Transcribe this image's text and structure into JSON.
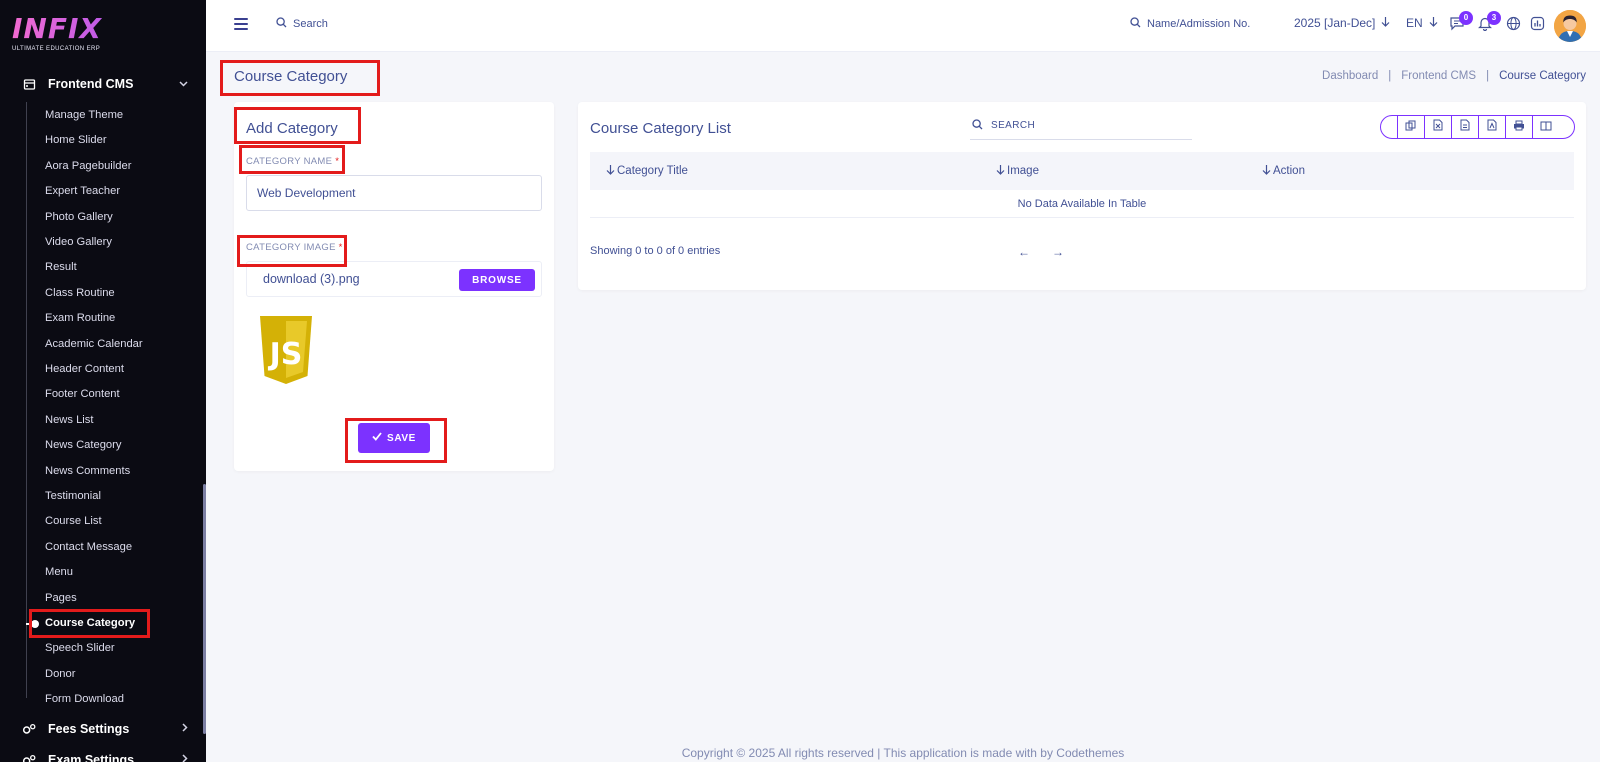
{
  "brand": {
    "logo_text": "INFIX",
    "tagline": "ULTIMATE EDUCATION ERP"
  },
  "sidebar": {
    "section_open": "Frontend CMS",
    "items": [
      "Manage Theme",
      "Home Slider",
      "Aora Pagebuilder",
      "Expert Teacher",
      "Photo Gallery",
      "Video Gallery",
      "Result",
      "Class Routine",
      "Exam Routine",
      "Academic Calendar",
      "Header Content",
      "Footer Content",
      "News List",
      "News Category",
      "News Comments",
      "Testimonial",
      "Course List",
      "Contact Message",
      "Menu",
      "Pages",
      "Course Category",
      "Speech Slider",
      "Donor",
      "Form Download"
    ],
    "active_item": "Course Category",
    "section_next": "Fees Settings",
    "section_after": "Exam Settings"
  },
  "topbar": {
    "search_label": "Search",
    "name_search_label": "Name/Admission No.",
    "year": "2025 [Jan-Dec]",
    "language": "EN",
    "chat_count": "0",
    "notification_count": "3"
  },
  "page": {
    "title": "Course Category",
    "breadcrumb": [
      "Dashboard",
      "Frontend CMS",
      "Course Category"
    ]
  },
  "form": {
    "title": "Add Category",
    "name_label": "CATEGORY NAME",
    "name_value": "Web Development",
    "image_label": "CATEGORY IMAGE",
    "required_mark": "*",
    "file_name": "download (3).png",
    "browse_label": "BROWSE",
    "save_label": "SAVE",
    "preview_logo_text": "JS"
  },
  "list": {
    "title": "Course Category List",
    "search_label": "SEARCH",
    "columns": [
      "Category Title",
      "Image",
      "Action"
    ],
    "empty_text": "No Data Available In Table",
    "entries_text": "Showing 0 to 0 of 0 entries",
    "prev_symbol": "←",
    "next_symbol": "→"
  },
  "footer": {
    "text": "Copyright © 2025 All rights reserved | This application is made with by Codethemes"
  },
  "colors": {
    "accent": "#7c32ff",
    "highlight": "#e31b1b",
    "sidebar_bg": "#0b0b13",
    "text": "#415094"
  }
}
